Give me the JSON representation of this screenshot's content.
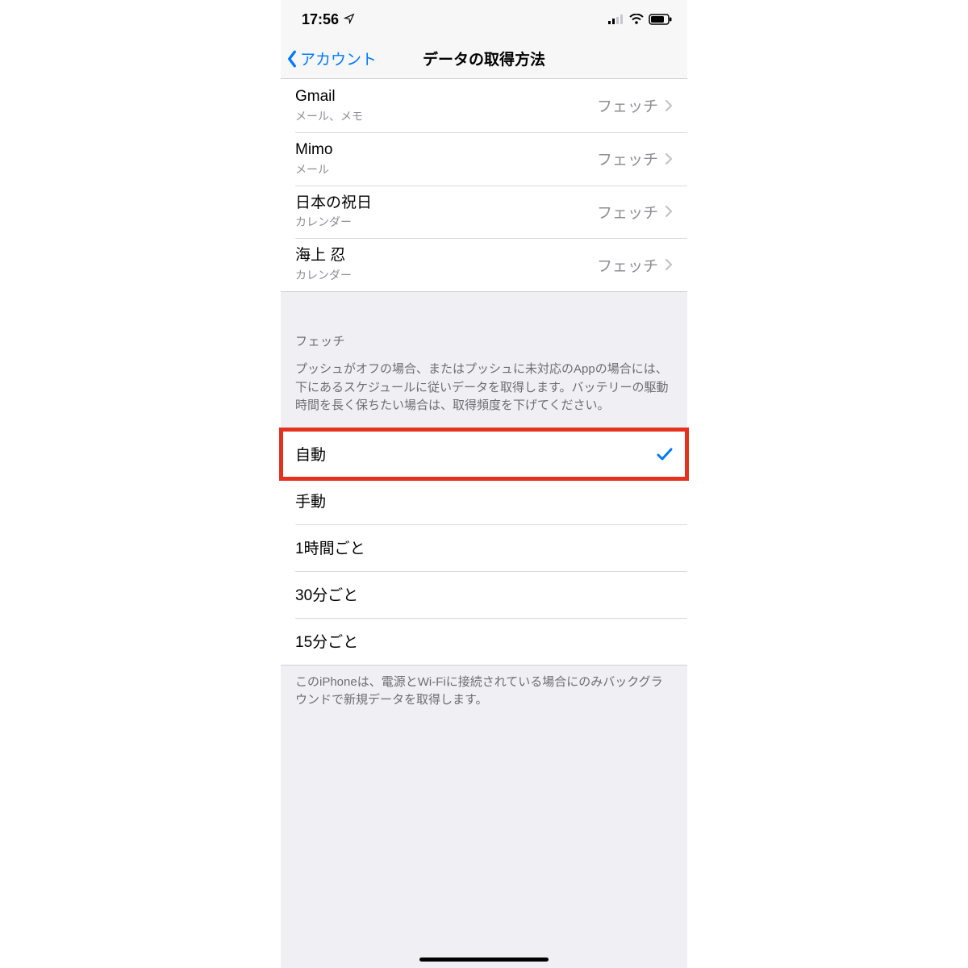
{
  "status": {
    "time": "17:56"
  },
  "nav": {
    "back_label": "アカウント",
    "title": "データの取得方法"
  },
  "accounts": [
    {
      "title": "Gmail",
      "sub": "メール、メモ",
      "value": "フェッチ"
    },
    {
      "title": "Mimo",
      "sub": "メール",
      "value": "フェッチ"
    },
    {
      "title": "日本の祝日",
      "sub": "カレンダー",
      "value": "フェッチ"
    },
    {
      "title": "海上 忍",
      "sub": "カレンダー",
      "value": "フェッチ"
    }
  ],
  "fetch": {
    "header": "フェッチ",
    "desc": "プッシュがオフの場合、またはプッシュに未対応のAppの場合には、下にあるスケジュールに従いデータを取得します。バッテリーの駆動時間を長く保ちたい場合は、取得頻度を下げてください。",
    "options": [
      {
        "label": "自動",
        "selected": true
      },
      {
        "label": "手動",
        "selected": false
      },
      {
        "label": "1時間ごと",
        "selected": false
      },
      {
        "label": "30分ごと",
        "selected": false
      },
      {
        "label": "15分ごと",
        "selected": false
      }
    ],
    "footer": "このiPhoneは、電源とWi-Fiに接続されている場合にのみバックグラウンドで新規データを取得します。"
  },
  "highlight_option_index": 0
}
